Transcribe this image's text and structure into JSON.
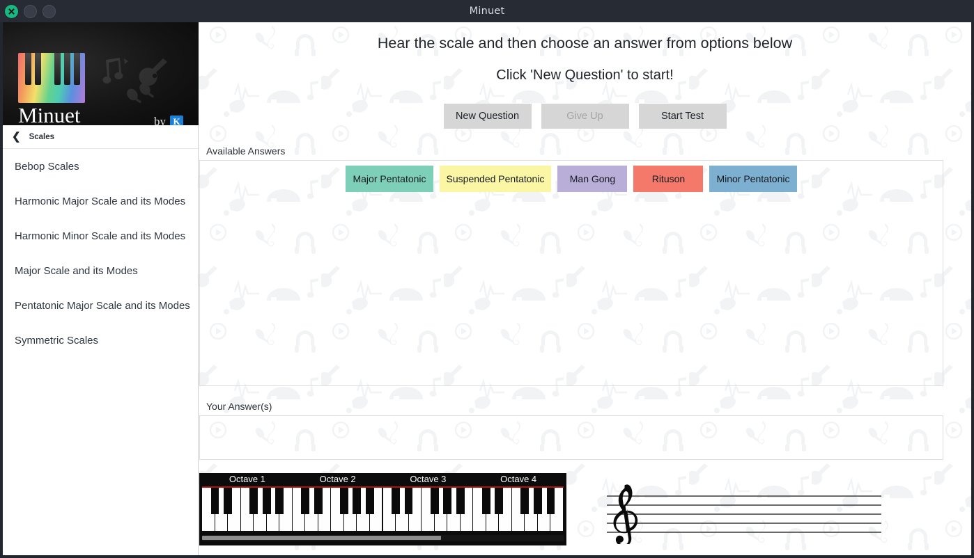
{
  "window": {
    "title": "Minuet",
    "close_icon": "close-x-icon",
    "minimize_icon": "minimize-icon",
    "maximize_icon": "maximize-icon"
  },
  "sidebar": {
    "logo": {
      "app_name": "Minuet",
      "by_label": "by",
      "vendor_badge": "K",
      "keyboard_icon": "rainbow-piano-keys-icon",
      "decoration_icons": [
        "music-notes-icon",
        "guitar-icon",
        "maracas-icon"
      ]
    },
    "header": {
      "back_icon": "chevron-left-icon",
      "label": "Scales"
    },
    "items": [
      {
        "label": "Bebop Scales"
      },
      {
        "label": "Harmonic Major Scale and its Modes"
      },
      {
        "label": "Harmonic Minor Scale and its Modes"
      },
      {
        "label": "Major Scale and its Modes"
      },
      {
        "label": "Pentatonic Major Scale and its Modes"
      },
      {
        "label": "Symmetric Scales"
      }
    ]
  },
  "main": {
    "prompt_line1": "Hear the scale and then choose an answer from options below",
    "prompt_line2": "Click 'New Question' to start!",
    "buttons": [
      {
        "label": "New Question",
        "enabled": true
      },
      {
        "label": "Give Up",
        "enabled": false
      },
      {
        "label": "Start Test",
        "enabled": true
      }
    ],
    "available_answers_label": "Available Answers",
    "your_answers_label": "Your Answer(s)",
    "answers": [
      {
        "label": "Major Pentatonic",
        "color": "#7ecfb8"
      },
      {
        "label": "Suspended Pentatonic",
        "color": "#faf6a4"
      },
      {
        "label": "Man Gong",
        "color": "#b9aed8"
      },
      {
        "label": "Rituson",
        "color": "#f4796b"
      },
      {
        "label": "Minor Pentatonic",
        "color": "#7dafd1"
      }
    ],
    "your_answers": []
  },
  "piano": {
    "octave_labels": [
      "Octave 1",
      "Octave 2",
      "Octave 3",
      "Octave 4"
    ],
    "white_key_count": 28,
    "scroll_thumb_percent": 66,
    "guide_line_color": "#b41010"
  },
  "staff": {
    "clef_icon": "treble-clef-icon",
    "line_count": 5,
    "notes": []
  },
  "colors": {
    "titlebar": "#272b33",
    "close_button": "#18b884",
    "button_face": "#d6d6d6",
    "panel_border": "#dcdcdc",
    "sidebar_logo_bg": "#151515"
  }
}
